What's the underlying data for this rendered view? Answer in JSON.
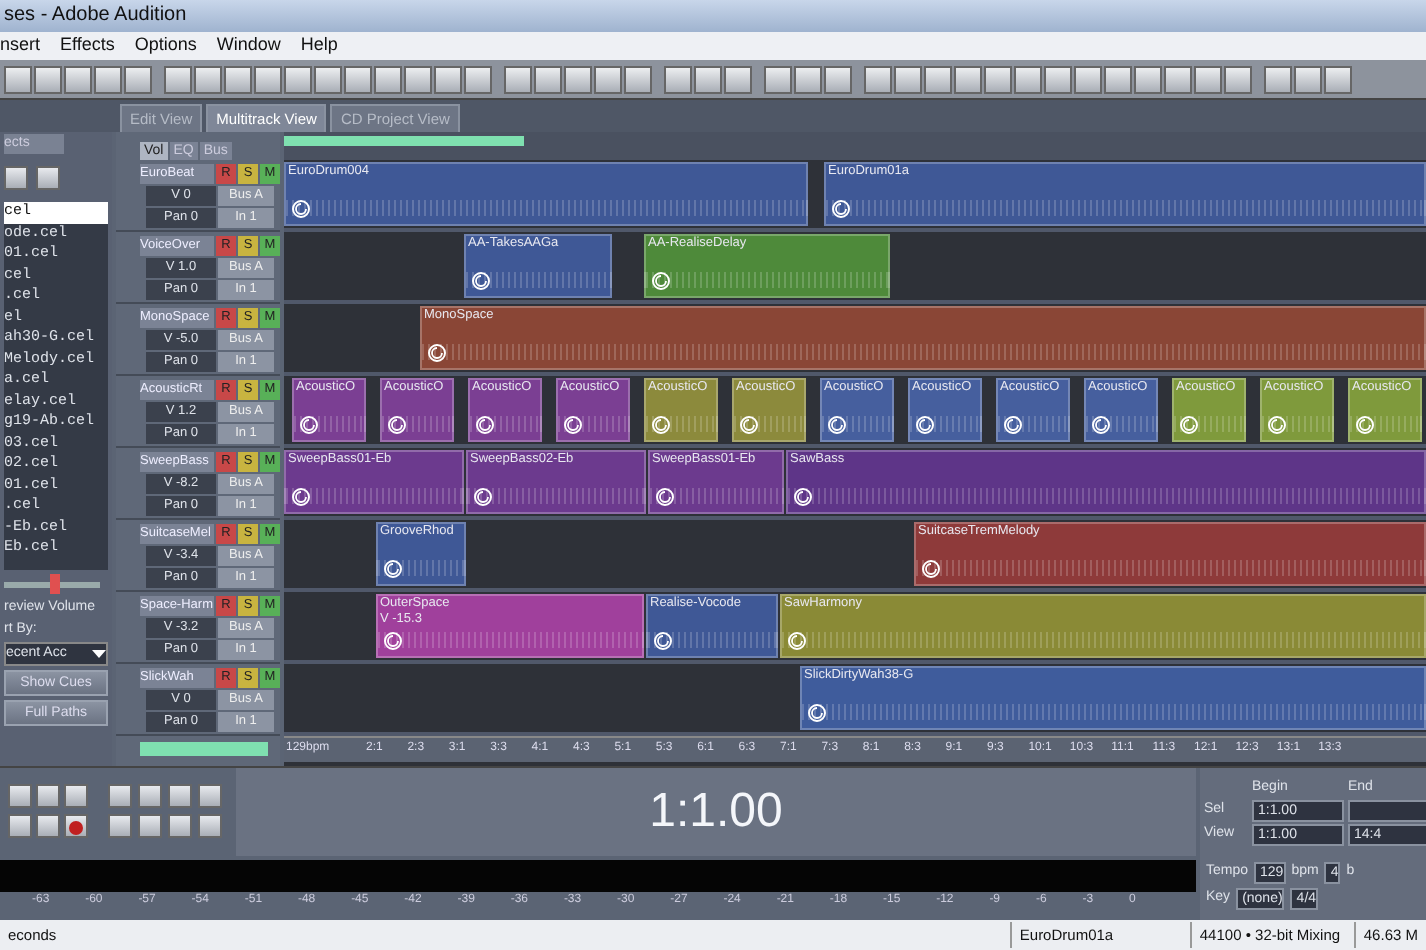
{
  "window": {
    "title": "ses - Adobe Audition"
  },
  "menu": [
    "nsert",
    "Effects",
    "Options",
    "Window",
    "Help"
  ],
  "view_tabs": [
    {
      "label": "Edit View",
      "selected": false
    },
    {
      "label": "Multitrack View",
      "selected": true
    },
    {
      "label": "CD Project View",
      "selected": false
    }
  ],
  "files_panel": {
    "tab": "ects",
    "files": [
      {
        "name": "cel",
        "selected": true
      },
      {
        "name": "ode.cel",
        "selected": false
      },
      {
        "name": "01.cel",
        "selected": false
      },
      {
        "name": "cel",
        "selected": false
      },
      {
        "name": ".cel",
        "selected": false
      },
      {
        "name": "el",
        "selected": false
      },
      {
        "name": "ah30-G.cel",
        "selected": false
      },
      {
        "name": "Melody.cel",
        "selected": false
      },
      {
        "name": "a.cel",
        "selected": false
      },
      {
        "name": "elay.cel",
        "selected": false
      },
      {
        "name": "g19-Ab.cel",
        "selected": false
      },
      {
        "name": "03.cel",
        "selected": false
      },
      {
        "name": "02.cel",
        "selected": false
      },
      {
        "name": "01.cel",
        "selected": false
      },
      {
        "name": ".cel",
        "selected": false
      },
      {
        "name": "-Eb.cel",
        "selected": false
      },
      {
        "name": "Eb.cel",
        "selected": false
      }
    ],
    "preview_volume": {
      "label": "review Volume",
      "level": 0.55
    },
    "sort_label": "rt By:",
    "sort_value": "ecent Acc",
    "buttons": [
      "Show Cues",
      "Full Paths"
    ]
  },
  "track_tabs": [
    {
      "label": "Vol",
      "selected": true
    },
    {
      "label": "EQ",
      "selected": false
    },
    {
      "label": "Bus",
      "selected": false
    }
  ],
  "tracks": [
    {
      "buttons": [
        "R",
        "S",
        "M"
      ],
      "name": "EuroBeat",
      "volume": "V 0",
      "pan": "Pan 0",
      "bus": "Bus A",
      "input": "In 1",
      "clips": [
        {
          "name": "EuroDrum004",
          "color": "#3f5896"
        },
        {
          "name": "EuroDrum01a",
          "color": "#3f5896"
        }
      ]
    },
    {
      "buttons": [
        "R",
        "S",
        "M"
      ],
      "name": "VoiceOver",
      "volume": "V 1.0",
      "pan": "Pan 0",
      "bus": "Bus A",
      "input": "In 1",
      "clips": [
        {
          "name": "AA-TakesAAGa",
          "color": "#3f5896"
        },
        {
          "name": "AA-RealiseDelay",
          "color": "#4e8a3a"
        }
      ]
    },
    {
      "buttons": [
        "R",
        "S",
        "M"
      ],
      "name": "MonoSpace",
      "volume": "V -5.0",
      "pan": "Pan 0",
      "bus": "Bus A",
      "input": "In 1",
      "clips": [
        {
          "name": "MonoSpace",
          "color": "#8a4636"
        }
      ]
    },
    {
      "buttons": [
        "R",
        "S",
        "M"
      ],
      "name": "AcousticRt",
      "volume": "V 1.2",
      "pan": "Pan 0",
      "bus": "Bus A",
      "input": "In 1",
      "clips": [
        {
          "name": "AcousticO",
          "color": "#7b3f93"
        },
        {
          "name": "AcousticO",
          "color": "#7b3f93"
        },
        {
          "name": "AcousticO",
          "color": "#7b3f93"
        },
        {
          "name": "AcousticO",
          "color": "#7b3f93"
        },
        {
          "name": "AcousticO",
          "color": "#8c8a3c"
        },
        {
          "name": "AcousticO",
          "color": "#8c8a3c"
        },
        {
          "name": "AcousticO",
          "color": "#465f9e"
        },
        {
          "name": "AcousticO",
          "color": "#465f9e"
        },
        {
          "name": "AcousticO",
          "color": "#465f9e"
        },
        {
          "name": "AcousticO",
          "color": "#465f9e"
        },
        {
          "name": "AcousticO",
          "color": "#7f9a3c"
        },
        {
          "name": "AcousticO",
          "color": "#7f9a3c"
        },
        {
          "name": "AcousticO",
          "color": "#7f9a3c"
        }
      ]
    },
    {
      "buttons": [
        "R",
        "S",
        "M"
      ],
      "name": "SweepBass",
      "volume": "V -8.2",
      "pan": "Pan 0",
      "bus": "Bus A",
      "input": "In 1",
      "clips": [
        {
          "name": "SweepBass01-Eb",
          "color": "#6c3a8e"
        },
        {
          "name": "SweepBass02-Eb",
          "color": "#6c3a8e"
        },
        {
          "name": "SweepBass01-Eb",
          "color": "#6c3a8e"
        },
        {
          "name": "SawBass",
          "color": "#5e3588"
        }
      ]
    },
    {
      "buttons": [
        "R",
        "S",
        "M"
      ],
      "name": "SuitcaseMel",
      "volume": "V -3.4",
      "pan": "Pan 0",
      "bus": "Bus A",
      "input": "In 1",
      "clips": [
        {
          "name": "GrooveRhod",
          "color": "#3f5896"
        },
        {
          "name": "SuitcaseTremMelody",
          "color": "#8e3a3a"
        }
      ]
    },
    {
      "buttons": [
        "R",
        "S",
        "M"
      ],
      "name": "Space-Harm",
      "volume": "V -3.2",
      "pan": "Pan 0",
      "bus": "Bus A",
      "input": "In 1",
      "clips": [
        {
          "name": "OuterSpace",
          "color": "#a0409c",
          "note": "V -15.3"
        },
        {
          "name": "Realise-Vocode",
          "color": "#3f5896"
        },
        {
          "name": "SawHarmony",
          "color": "#8a8a36"
        }
      ]
    },
    {
      "buttons": [
        "R",
        "S",
        "M"
      ],
      "name": "SlickWah",
      "volume": "V 0",
      "pan": "Pan 0",
      "bus": "Bus A",
      "input": "In 1",
      "clips": [
        {
          "name": "SlickDirtyWah38-G",
          "color": "#3f5c9c"
        }
      ]
    }
  ],
  "ruler": {
    "tempo": "129bpm",
    "marks": [
      "2:1",
      "2:3",
      "3:1",
      "3:3",
      "4:1",
      "4:3",
      "5:1",
      "5:3",
      "6:1",
      "6:3",
      "7:1",
      "7:3",
      "8:1",
      "8:3",
      "9:1",
      "9:3",
      "10:1",
      "10:3",
      "11:1",
      "11:3",
      "12:1",
      "12:3",
      "13:1",
      "13:3"
    ]
  },
  "time_display": "1:1.00",
  "range": {
    "begin_label": "Begin",
    "end_label": "End",
    "sel_label": "Sel",
    "sel_begin": "1:1.00",
    "view_label": "View",
    "view_begin": "1:1.00",
    "view_end": "14:4"
  },
  "tempo": {
    "label": "Tempo",
    "value": "129",
    "unit": "bpm",
    "beats": "4",
    "beats_unit": "b",
    "key_label": "Key",
    "key_value": "(none)",
    "signature": "4/4"
  },
  "meter_scale": [
    "-63",
    "-60",
    "-57",
    "-54",
    "-51",
    "-48",
    "-45",
    "-42",
    "-39",
    "-36",
    "-33",
    "-30",
    "-27",
    "-24",
    "-21",
    "-18",
    "-15",
    "-12",
    "-9",
    "-6",
    "-3",
    "0"
  ],
  "status_bar": {
    "message": "econds",
    "file": "EuroDrum01a",
    "format": "44100 • 32-bit Mixing",
    "memory": "46.63 M"
  }
}
